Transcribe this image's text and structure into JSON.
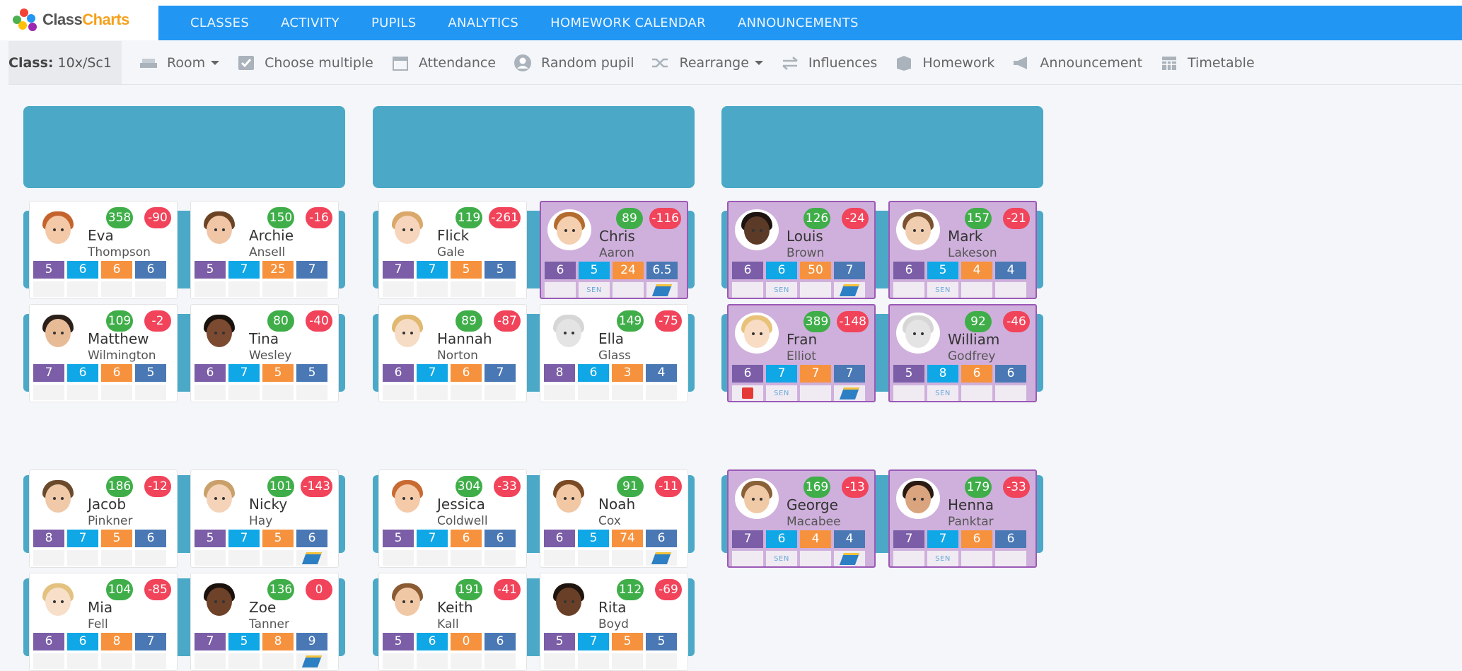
{
  "app": {
    "brand_a": "Class",
    "brand_b": "Charts"
  },
  "nav": [
    "CLASSES",
    "ACTIVITY",
    "PUPILS",
    "ANALYTICS",
    "HOMEWORK CALENDAR",
    "ANNOUNCEMENTS"
  ],
  "toolbar": {
    "class_label": "Class:",
    "class_value": "10x/Sc1",
    "room": "Room",
    "choose_multiple": "Choose multiple",
    "attendance": "Attendance",
    "random_pupil": "Random pupil",
    "rearrange": "Rearrange",
    "influences": "Influences",
    "homework": "Homework",
    "announcement": "Announcement",
    "timetable": "Timetable"
  },
  "sen_tag": "SEN",
  "pupils": [
    {
      "first": "Eva",
      "last": "Thompson",
      "pos": "358",
      "neg": "-90",
      "stats": [
        "5",
        "6",
        "6",
        "6"
      ],
      "sen": false,
      "hw": false,
      "hair": "#c4632c",
      "skin": "#f3c9a8"
    },
    {
      "first": "Archie",
      "last": "Ansell",
      "pos": "150",
      "neg": "-16",
      "stats": [
        "5",
        "7",
        "25",
        "7"
      ],
      "sen": false,
      "hw": false,
      "hair": "#6b4426",
      "skin": "#f0c6a6"
    },
    {
      "first": "Flick",
      "last": "Gale",
      "pos": "119",
      "neg": "-261",
      "stats": [
        "7",
        "7",
        "5",
        "5"
      ],
      "sen": false,
      "hw": false,
      "hair": "#d9a86a",
      "skin": "#f6d5bc"
    },
    {
      "first": "Chris",
      "last": "Aaron",
      "pos": "89",
      "neg": "-116",
      "stats": [
        "6",
        "5",
        "24",
        "6.5"
      ],
      "sen": true,
      "hw": true,
      "hair": "#b36b2e",
      "skin": "#f4cfb0"
    },
    {
      "first": "Louis",
      "last": "Brown",
      "pos": "126",
      "neg": "-24",
      "stats": [
        "6",
        "6",
        "50",
        "7"
      ],
      "sen": true,
      "hw": true,
      "hair": "#1e1410",
      "skin": "#5b3a27"
    },
    {
      "first": "Mark",
      "last": "Lakeson",
      "pos": "157",
      "neg": "-21",
      "stats": [
        "6",
        "5",
        "4",
        "4"
      ],
      "sen": true,
      "hw": false,
      "hair": "#7a5230",
      "skin": "#f1cdb0"
    },
    {
      "first": "Matthew",
      "last": "Wilmington",
      "pos": "109",
      "neg": "-2",
      "stats": [
        "7",
        "6",
        "6",
        "5"
      ],
      "sen": false,
      "hw": false,
      "hair": "#2b2019",
      "skin": "#e8bb97"
    },
    {
      "first": "Tina",
      "last": "Wesley",
      "pos": "80",
      "neg": "-40",
      "stats": [
        "6",
        "7",
        "5",
        "5"
      ],
      "sen": false,
      "hw": false,
      "hair": "#1a120d",
      "skin": "#7b4a30"
    },
    {
      "first": "Hannah",
      "last": "Norton",
      "pos": "89",
      "neg": "-87",
      "stats": [
        "6",
        "7",
        "6",
        "7"
      ],
      "sen": false,
      "hw": false,
      "hair": "#e0b86f",
      "skin": "#f7dcc5"
    },
    {
      "first": "Ella",
      "last": "Glass",
      "pos": "149",
      "neg": "-75",
      "stats": [
        "8",
        "6",
        "3",
        "4"
      ],
      "sen": false,
      "hw": false,
      "hair": "#d6d6d6",
      "skin": "#e4e4e4"
    },
    {
      "first": "Fran",
      "last": "Elliot",
      "pos": "389",
      "neg": "-148",
      "stats": [
        "6",
        "7",
        "7",
        "7"
      ],
      "sen": true,
      "hw": true,
      "flag": true,
      "hair": "#e9c27a",
      "skin": "#f8dcc4"
    },
    {
      "first": "William",
      "last": "Godfrey",
      "pos": "92",
      "neg": "-46",
      "stats": [
        "5",
        "8",
        "6",
        "6"
      ],
      "sen": true,
      "hw": false,
      "hair": "#d6d6d6",
      "skin": "#e4e4e4"
    },
    {
      "first": "Jacob",
      "last": "Pinkner",
      "pos": "186",
      "neg": "-12",
      "stats": [
        "8",
        "7",
        "5",
        "6"
      ],
      "sen": false,
      "hw": false,
      "hair": "#6b4a2c",
      "skin": "#f0c9a8"
    },
    {
      "first": "Nicky",
      "last": "Hay",
      "pos": "101",
      "neg": "-143",
      "stats": [
        "5",
        "7",
        "5",
        "6"
      ],
      "sen": false,
      "hw": true,
      "hair": "#caa06a",
      "skin": "#f5d3b8"
    },
    {
      "first": "Jessica",
      "last": "Coldwell",
      "pos": "304",
      "neg": "-33",
      "stats": [
        "5",
        "7",
        "6",
        "6"
      ],
      "sen": false,
      "hw": false,
      "hair": "#c86a32",
      "skin": "#f4caa9"
    },
    {
      "first": "Noah",
      "last": "Cox",
      "pos": "91",
      "neg": "-11",
      "stats": [
        "6",
        "5",
        "74",
        "6"
      ],
      "sen": false,
      "hw": true,
      "hair": "#7a4a25",
      "skin": "#f1c7a4"
    },
    {
      "first": "George",
      "last": "Macabee",
      "pos": "169",
      "neg": "-13",
      "stats": [
        "7",
        "6",
        "4",
        "4"
      ],
      "sen": true,
      "hw": true,
      "hair": "#8a6038",
      "skin": "#f0c9a6"
    },
    {
      "first": "Henna",
      "last": "Panktar",
      "pos": "179",
      "neg": "-33",
      "stats": [
        "7",
        "7",
        "6",
        "6"
      ],
      "sen": true,
      "hw": false,
      "hair": "#2a1a12",
      "skin": "#d9a47e"
    },
    {
      "first": "Mia",
      "last": "Fell",
      "pos": "104",
      "neg": "-85",
      "stats": [
        "6",
        "6",
        "8",
        "7"
      ],
      "sen": false,
      "hw": false,
      "hair": "#e3c17f",
      "skin": "#f8dfca"
    },
    {
      "first": "Zoe",
      "last": "Tanner",
      "pos": "136",
      "neg": "0",
      "stats": [
        "7",
        "5",
        "8",
        "9"
      ],
      "sen": false,
      "hw": true,
      "hair": "#1a110c",
      "skin": "#6e4129"
    },
    {
      "first": "Keith",
      "last": "Kall",
      "pos": "191",
      "neg": "-41",
      "stats": [
        "5",
        "6",
        "0",
        "6"
      ],
      "sen": false,
      "hw": false,
      "hair": "#8a5a32",
      "skin": "#f1c8a6"
    },
    {
      "first": "Rita",
      "last": "Boyd",
      "pos": "112",
      "neg": "-69",
      "stats": [
        "5",
        "7",
        "5",
        "5"
      ],
      "sen": false,
      "hw": false,
      "hair": "#1f140e",
      "skin": "#6a3f28"
    }
  ]
}
